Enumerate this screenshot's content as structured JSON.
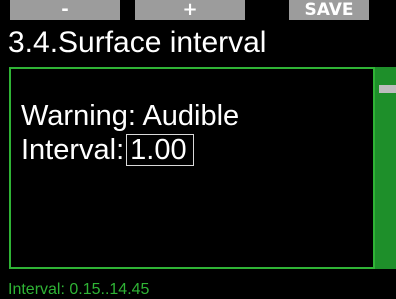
{
  "softkeys": {
    "left_label": "-",
    "middle_label": "+",
    "right_label": "SAVE"
  },
  "screen": {
    "title": "3.4.Surface interval"
  },
  "settings": {
    "warning_label": "Warning:",
    "warning_value": "Audible",
    "interval_label": "Interval:",
    "interval_value": "1.00"
  },
  "status": {
    "range_text": "Interval: 0.15..14.45"
  },
  "colors": {
    "accent_green": "#2fb335",
    "softkey_gray": "#9c9c9c",
    "background": "#000000"
  }
}
